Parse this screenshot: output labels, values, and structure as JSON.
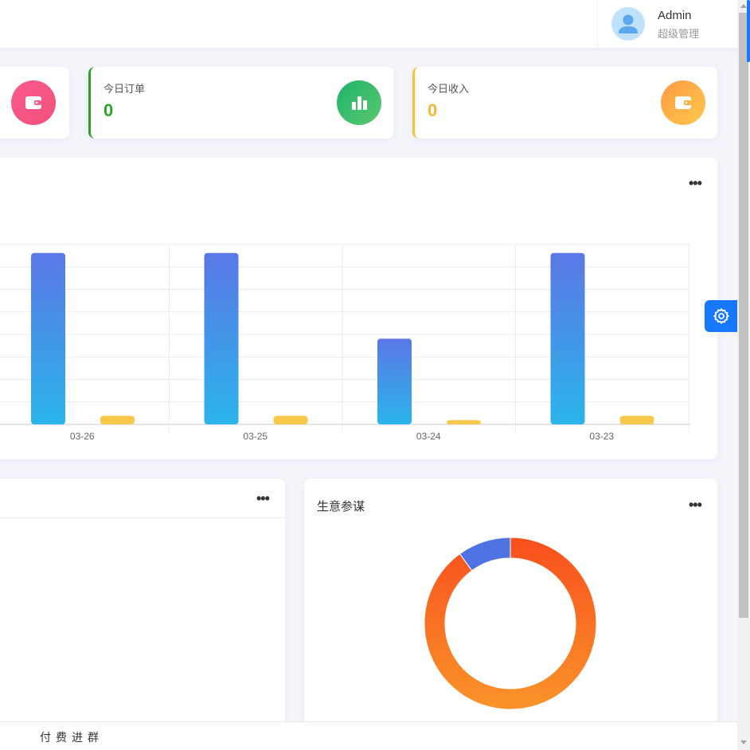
{
  "header": {
    "user_name": "Admin",
    "user_role": "超级管理",
    "avatar_icon": "user-avatar-icon"
  },
  "stats": [
    {
      "label": "",
      "value": "",
      "icon": "wallet-icon",
      "color": "#f0517a"
    },
    {
      "label": "今日订单",
      "value": "0",
      "icon": "bar-chart-icon",
      "color": "#2aa32a"
    },
    {
      "label": "今日收入",
      "value": "0",
      "icon": "wallet-icon",
      "color": "#f5b82e"
    }
  ],
  "chart_data": [
    {
      "type": "bar",
      "categories": [
        "03-26",
        "03-25",
        "03-24",
        "03-23"
      ],
      "series": [
        {
          "values": [
            10,
            10,
            5,
            10
          ],
          "color": "#2bb4ea"
        },
        {
          "values": [
            0.5,
            0.5,
            0.25,
            0.5
          ],
          "color": "#f7c84a"
        }
      ],
      "title": "",
      "ylim": [
        0,
        10.5
      ],
      "grid": true
    },
    {
      "type": "pie",
      "donut": true,
      "title": "生意参谋",
      "values": [
        90,
        10
      ],
      "colors": [
        "#fb5a1f",
        "#4f73e3"
      ]
    }
  ],
  "cards": {
    "left_title": "",
    "right_title": "生意参谋",
    "more_label": "•••"
  },
  "footer": {
    "text": "付费进群"
  },
  "floating": {
    "settings_icon": "gear-icon"
  }
}
